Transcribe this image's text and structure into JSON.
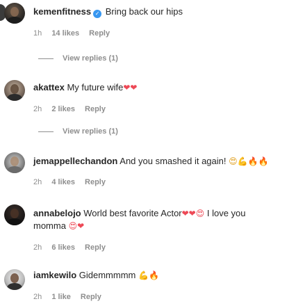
{
  "comments": [
    {
      "username": "kemenfitness",
      "verified": true,
      "text": "Bring back our hips",
      "emoji": "",
      "continued": "",
      "time": "1h",
      "likes": "14 likes",
      "reply": "Reply",
      "view_replies": "View replies (1)"
    },
    {
      "username": "akattex",
      "verified": false,
      "text": "My future wife",
      "emoji": "❤❤",
      "continued": "",
      "time": "2h",
      "likes": "2 likes",
      "reply": "Reply",
      "view_replies": "View replies (1)"
    },
    {
      "username": "jemappellechandon",
      "verified": false,
      "text": "And you smashed it again!",
      "emoji": "😍💪🔥🔥",
      "continued": "",
      "time": "2h",
      "likes": "4 likes",
      "reply": "Reply",
      "view_replies": ""
    },
    {
      "username": "annabelojo",
      "verified": false,
      "text": "World best favorite Actor",
      "emoji": "❤❤😍",
      "continued": "I love you",
      "continued2": "momma",
      "emoji2": "😍❤",
      "time": "2h",
      "likes": "6 likes",
      "reply": "Reply",
      "view_replies": ""
    },
    {
      "username": "iamkewilo",
      "verified": false,
      "text": "Gidemmmmm",
      "emoji": "💪🔥",
      "continued": "",
      "time": "2h",
      "likes": "1 like",
      "reply": "Reply",
      "view_replies": ""
    }
  ],
  "colors": {
    "text": "#262626",
    "muted": "#8e8e8e",
    "verified": "#3897f0",
    "heart": "#ed4956"
  }
}
